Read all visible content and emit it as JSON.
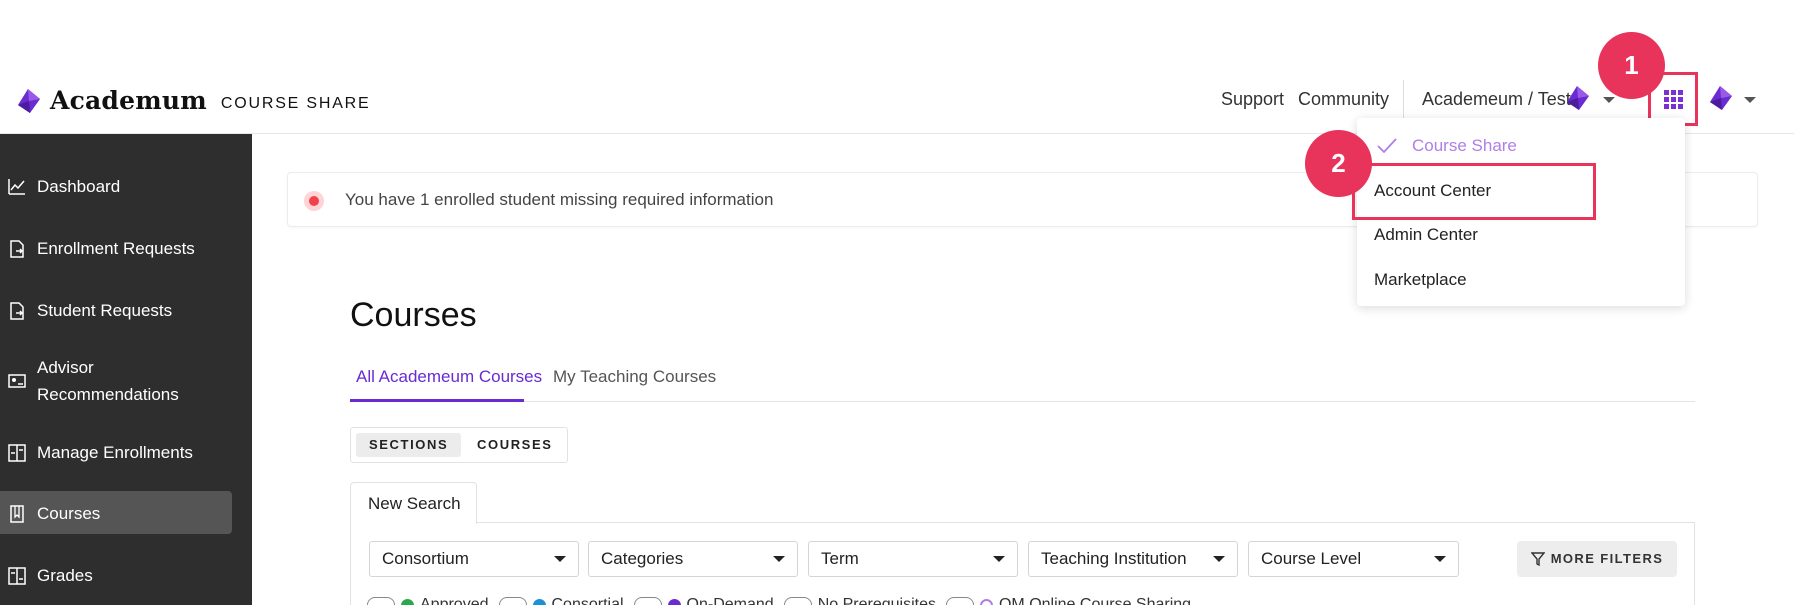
{
  "brand": {
    "name": "Academ",
    "name_suffix": "um",
    "product": "COURSE SHARE",
    "color": "#6a2bd1"
  },
  "header": {
    "links": [
      "Support",
      "Community"
    ],
    "org_label": "Academeum / Test",
    "icons": [
      "academeum-gem-icon",
      "apps-grid-icon"
    ]
  },
  "sidebar": {
    "bg_color": "#2e2e2e",
    "items": [
      {
        "label": "Dashboard",
        "icon": "chart-line-icon"
      },
      {
        "label": "Enrollment Requests",
        "icon": "document-arrow-icon"
      },
      {
        "label": "Student Requests",
        "icon": "document-arrow-icon"
      },
      {
        "label": "Advisor Recommendations",
        "icon": "advisor-card-icon"
      },
      {
        "label": "Manage Enrollments",
        "icon": "enrollments-icon"
      },
      {
        "label": "Courses",
        "icon": "book-icon",
        "active": true
      },
      {
        "label": "Grades",
        "icon": "grades-icon"
      }
    ]
  },
  "alert": {
    "text": "You have 1 enrolled student missing required information",
    "color": "#f0424a"
  },
  "main": {
    "title": "Courses",
    "tabs": [
      {
        "label": "All Academeum Courses",
        "active": true
      },
      {
        "label": "My Teaching Courses",
        "active": false
      }
    ],
    "view_toggle": [
      {
        "label": "SECTIONS",
        "active": true
      },
      {
        "label": "COURSES",
        "active": false
      }
    ],
    "search_tab": "New Search",
    "filters": [
      "Consortium",
      "Categories",
      "Term",
      "Teaching Institution",
      "Course Level"
    ],
    "more_filters_label": "MORE FILTERS",
    "chips": [
      {
        "label": "Approved",
        "color": "#2aa84a"
      },
      {
        "label": "Consortial",
        "color": "#1f8fd6"
      },
      {
        "label": "On-Demand",
        "color": "#6a2bd1"
      },
      {
        "label": "No Prerequisites",
        "color": ""
      },
      {
        "label": "QM Online Course Sharing",
        "color": "#b07ee6"
      }
    ]
  },
  "app_menu": {
    "items": [
      {
        "label": "Course Share",
        "current": true
      },
      {
        "label": "Account Center",
        "current": false
      },
      {
        "label": "Admin Center",
        "current": false
      },
      {
        "label": "Marketplace",
        "current": false
      }
    ]
  },
  "annotations": {
    "step1": "1",
    "step2": "2",
    "color": "#e8335b"
  }
}
